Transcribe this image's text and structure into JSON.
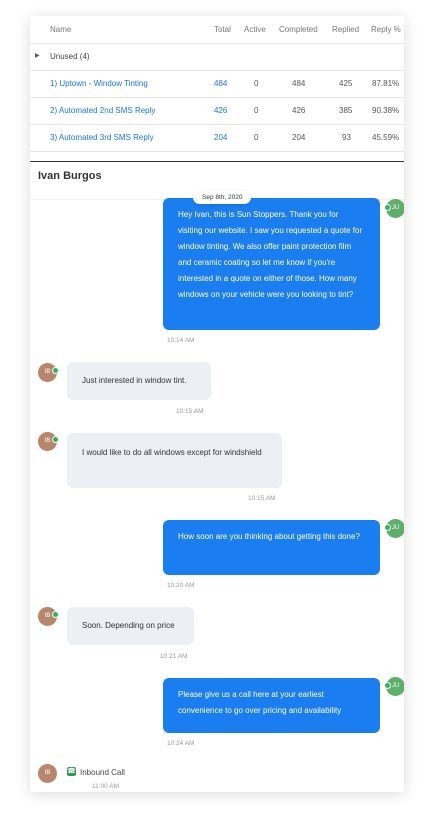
{
  "table": {
    "headers": [
      "Name",
      "Total",
      "Active",
      "Completed",
      "Replied",
      "Reply %"
    ],
    "group_label": "Unused (4)",
    "rows": [
      {
        "name": "1) Uptown - Window Tinting",
        "total": "484",
        "active": "0",
        "completed": "484",
        "replied": "425",
        "reply_pct": "87.81%"
      },
      {
        "name": "2) Automated 2nd SMS Reply",
        "total": "426",
        "active": "0",
        "completed": "426",
        "replied": "385",
        "reply_pct": "90.38%"
      },
      {
        "name": "3) Automated 3rd SMS Reply",
        "total": "204",
        "active": "0",
        "completed": "204",
        "replied": "93",
        "reply_pct": "45.59%"
      }
    ]
  },
  "contact_name": "Ivan Burgos",
  "date_pill": "Sep 8th, 2020",
  "avatars": {
    "contact": "IB",
    "agent": "JU"
  },
  "messages": [
    {
      "text": "Hey Ivan, this is Sun Stoppers. Thank you for visiting our website. I saw you requested a quote for window tinting. We also offer paint protection film and ceramic coating so let me know if you're interested in a quote on either of those. How many windows on your vehicle were you looking to tint?",
      "time": "10:14 AM"
    },
    {
      "text": "Just interested in window tint.",
      "time": "10:15 AM"
    },
    {
      "text": "I would like to do all windows except for windshield",
      "time": "10:15 AM"
    },
    {
      "text": "How soon are you thinking about getting this done?",
      "time": "10:20 AM"
    },
    {
      "text": "Soon. Depending on price",
      "time": "10:21 AM"
    },
    {
      "text": "Please give us a call here at your earliest convenience to go over pricing and availability",
      "time": "10:24 AM"
    }
  ],
  "call": {
    "label": "Inbound Call",
    "time": "11:00 AM"
  },
  "colors": {
    "outgoing": "#1a7ef0",
    "incoming": "#eceff4",
    "link": "#1a73e8",
    "online": "#2fb35c"
  }
}
